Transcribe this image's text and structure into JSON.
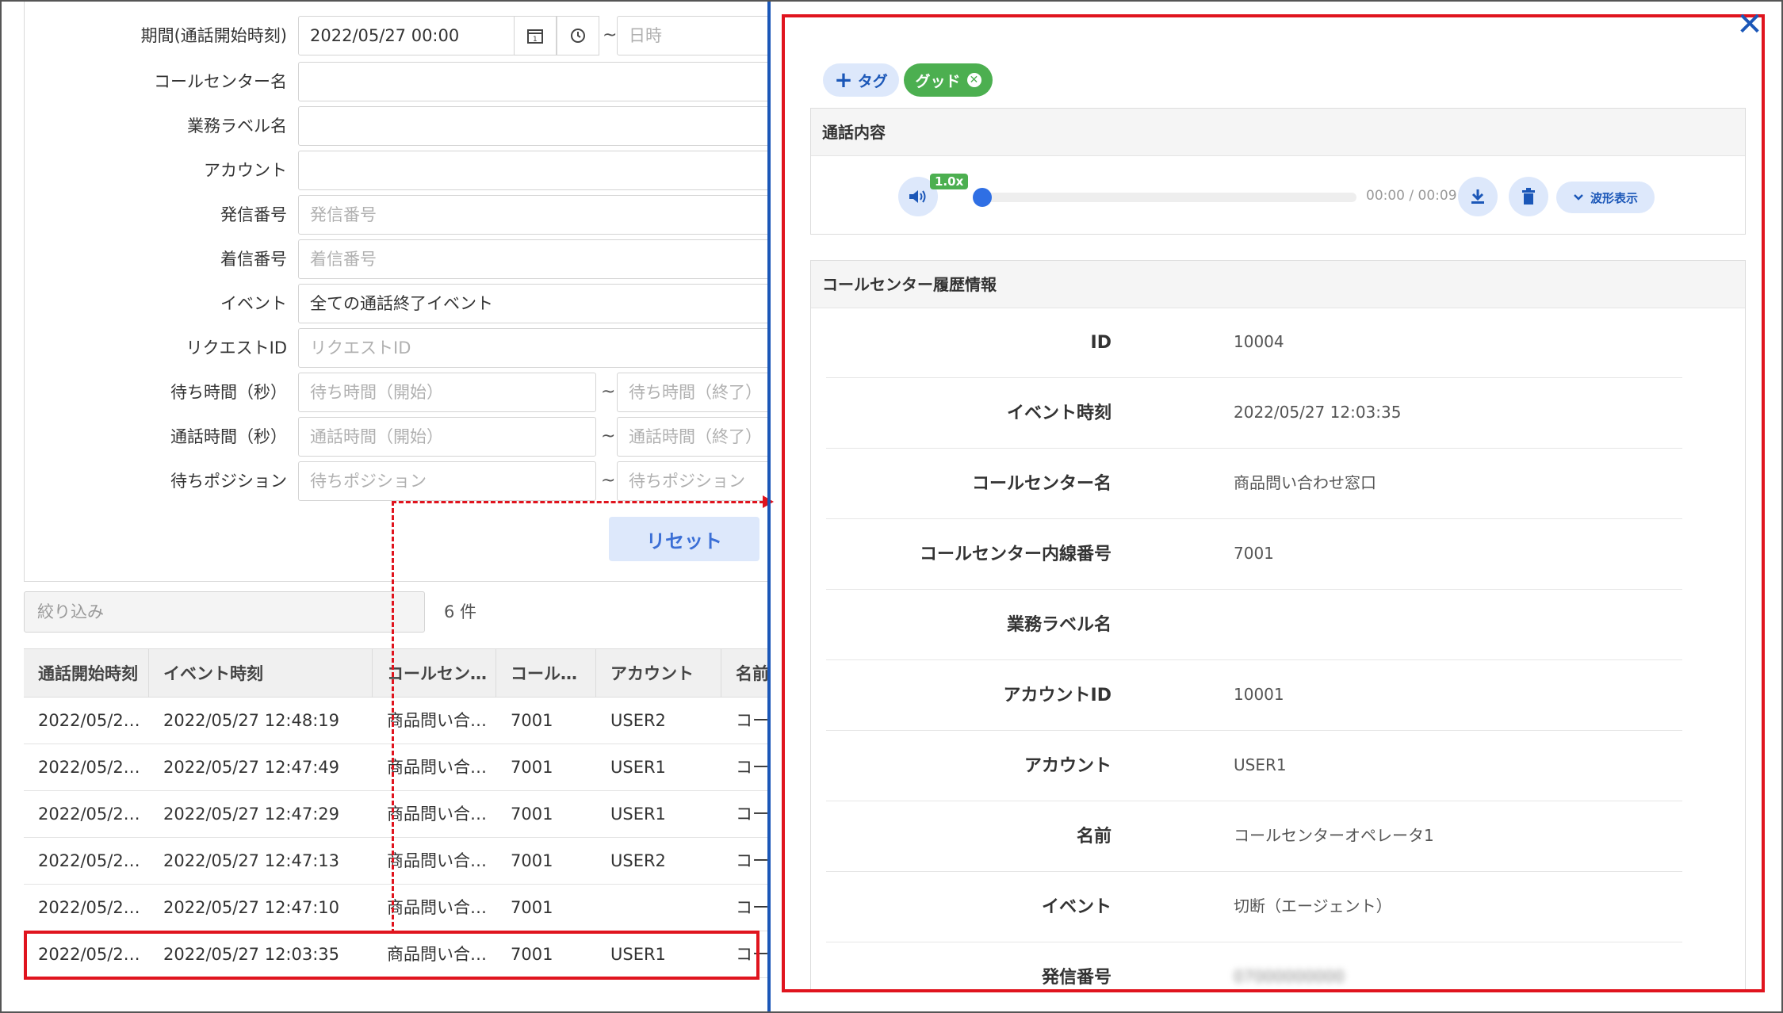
{
  "filters": {
    "period_label": "期間(通話開始時刻)",
    "period_start": "2022/05/27 00:00",
    "period_end_placeholder": "日時",
    "tilde": "~",
    "callcenter_label": "コールセンター名",
    "business_label": "業務ラベル名",
    "account_label": "アカウント",
    "caller_label": "発信番号",
    "caller_placeholder": "発信番号",
    "callee_label": "着信番号",
    "callee_placeholder": "着信番号",
    "event_label": "イベント",
    "event_value": "全ての通話終了イベント",
    "request_label": "リクエストID",
    "request_placeholder": "リクエストID",
    "wait_label": "待ち時間（秒）",
    "wait_start_placeholder": "待ち時間（開始）",
    "wait_end_placeholder": "待ち時間（終了）",
    "talk_label": "通話時間（秒）",
    "talk_start_placeholder": "通話時間（開始）",
    "talk_end_placeholder": "通話時間（終了）",
    "pos_label": "待ちポジション",
    "pos_start_placeholder": "待ちポジション",
    "pos_end_placeholder": "待ちポジション",
    "reset_label": "リセット"
  },
  "list": {
    "narrow_placeholder": "絞り込み",
    "count": "6 件",
    "headers": [
      "通話開始時刻",
      "イベント時刻",
      "コールセン…",
      "コール…",
      "アカウント",
      "名前"
    ],
    "rows": [
      [
        "2022/05/2…",
        "2022/05/27 12:48:19",
        "商品問い合…",
        "7001",
        "USER2",
        "コー"
      ],
      [
        "2022/05/2…",
        "2022/05/27 12:47:49",
        "商品問い合…",
        "7001",
        "USER1",
        "コー"
      ],
      [
        "2022/05/2…",
        "2022/05/27 12:47:29",
        "商品問い合…",
        "7001",
        "USER1",
        "コー"
      ],
      [
        "2022/05/2…",
        "2022/05/27 12:47:13",
        "商品問い合…",
        "7001",
        "USER2",
        "コー"
      ],
      [
        "2022/05/2…",
        "2022/05/27 12:47:10",
        "商品問い合…",
        "7001",
        "",
        "コー"
      ],
      [
        "2022/05/2…",
        "2022/05/27 12:03:35",
        "商品問い合…",
        "7001",
        "USER1",
        "コー"
      ]
    ]
  },
  "detail": {
    "close": "✕",
    "tag_add": "タグ",
    "tag_good": "グッド",
    "call_section_title": "通話内容",
    "speed": "1.0x",
    "time": "00:00 / 00:09",
    "wave_label": "波形表示",
    "history_title": "コールセンター履歴情報",
    "fields": [
      {
        "label": "ID",
        "value": "10004"
      },
      {
        "label": "イベント時刻",
        "value": "2022/05/27 12:03:35"
      },
      {
        "label": "コールセンター名",
        "value": "商品問い合わせ窓口"
      },
      {
        "label": "コールセンター内線番号",
        "value": "7001"
      },
      {
        "label": "業務ラベル名",
        "value": ""
      },
      {
        "label": "アカウントID",
        "value": "10001"
      },
      {
        "label": "アカウント",
        "value": "USER1"
      },
      {
        "label": "名前",
        "value": "コールセンターオペレータ1"
      },
      {
        "label": "イベント",
        "value": "切断（エージェント）"
      },
      {
        "label": "発信番号",
        "value": "07000000000"
      }
    ]
  },
  "colors": {
    "highlight": "#e0141e",
    "divider": "#1b57b8",
    "good_tag": "#4caf50",
    "accent": "#2f6fe4"
  }
}
